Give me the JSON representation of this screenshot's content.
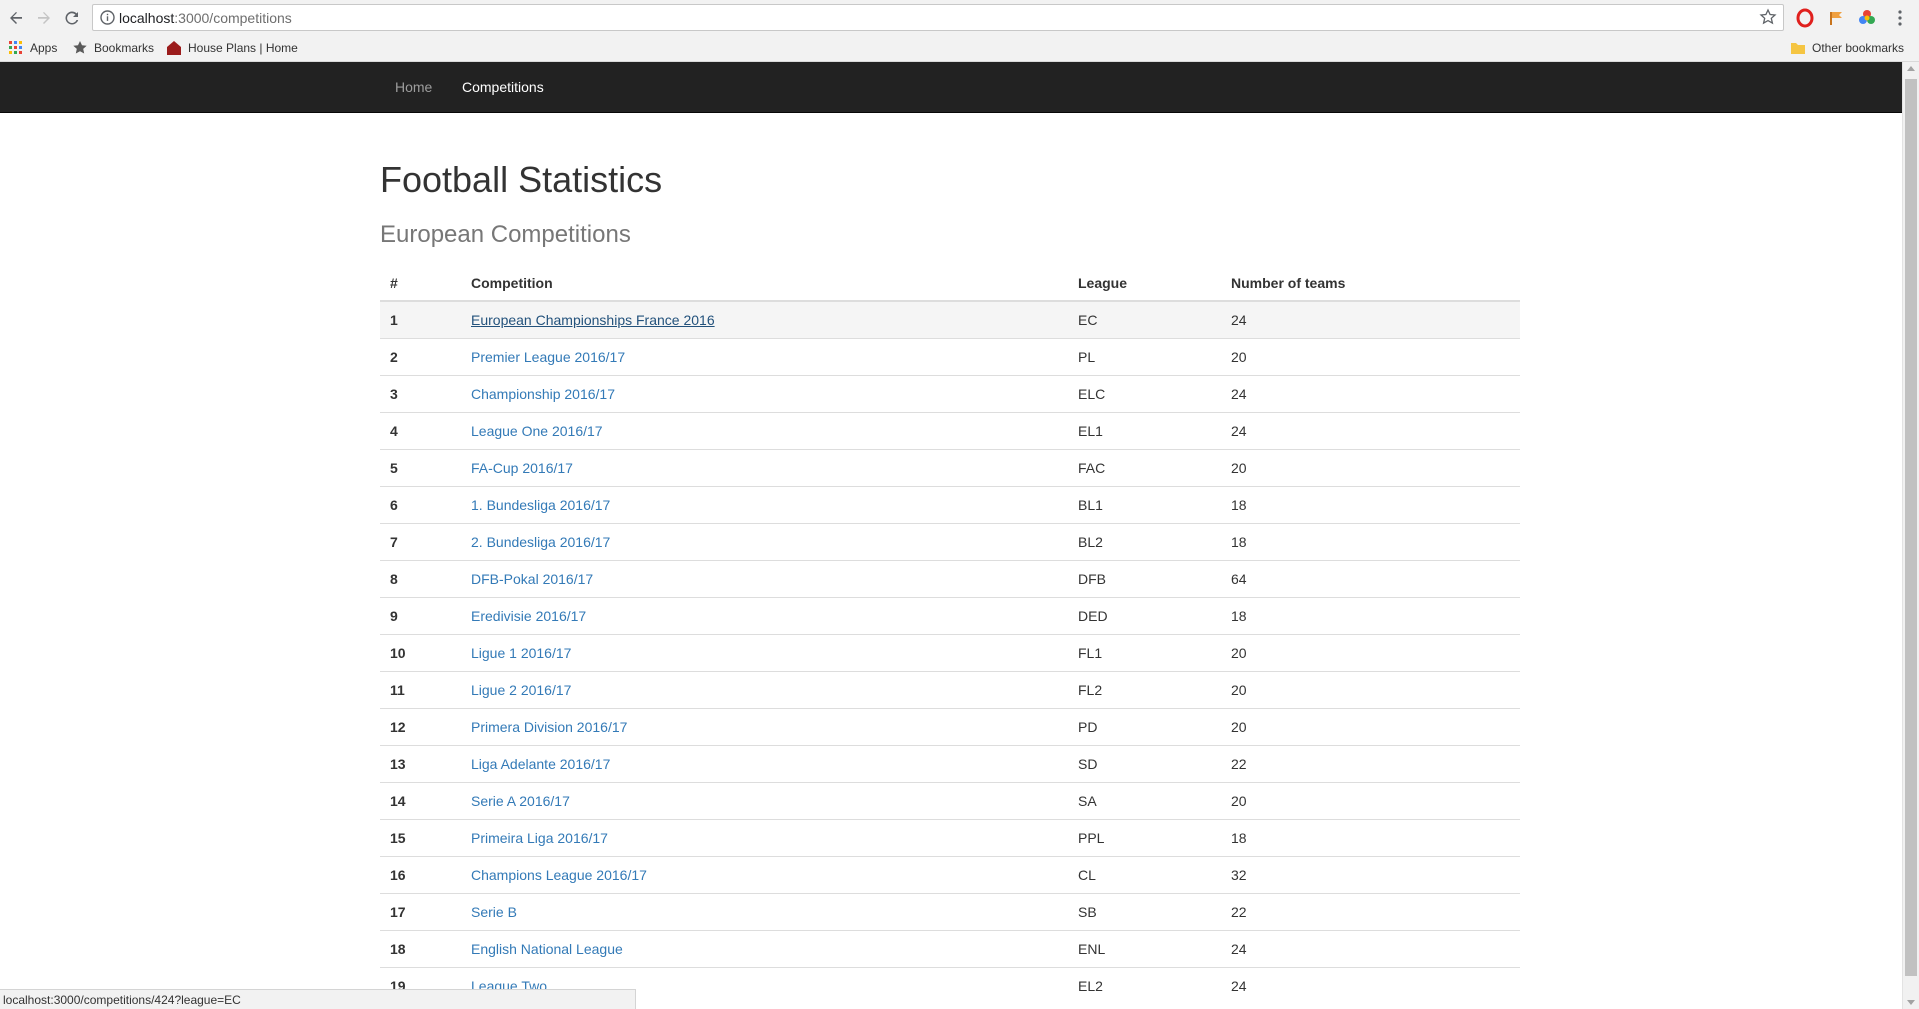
{
  "browser": {
    "url_host": "localhost",
    "url_path": ":3000/competitions",
    "bookmarks": {
      "apps": "Apps",
      "bookmarks": "Bookmarks",
      "house_plans": "House Plans | Home",
      "other": "Other bookmarks"
    },
    "status_url": "localhost:3000/competitions/424?league=EC"
  },
  "nav": {
    "home": "Home",
    "competitions": "Competitions"
  },
  "page": {
    "title": "Football Statistics",
    "subtitle": "European Competitions"
  },
  "table": {
    "headers": [
      "#",
      "Competition",
      "League",
      "Number of teams"
    ],
    "rows": [
      {
        "num": "1",
        "name": "European Championships France 2016",
        "league": "EC",
        "teams": "24"
      },
      {
        "num": "2",
        "name": "Premier League 2016/17",
        "league": "PL",
        "teams": "20"
      },
      {
        "num": "3",
        "name": "Championship 2016/17",
        "league": "ELC",
        "teams": "24"
      },
      {
        "num": "4",
        "name": "League One 2016/17",
        "league": "EL1",
        "teams": "24"
      },
      {
        "num": "5",
        "name": "FA-Cup 2016/17",
        "league": "FAC",
        "teams": "20"
      },
      {
        "num": "6",
        "name": "1. Bundesliga 2016/17",
        "league": "BL1",
        "teams": "18"
      },
      {
        "num": "7",
        "name": "2. Bundesliga 2016/17",
        "league": "BL2",
        "teams": "18"
      },
      {
        "num": "8",
        "name": "DFB-Pokal 2016/17",
        "league": "DFB",
        "teams": "64"
      },
      {
        "num": "9",
        "name": "Eredivisie 2016/17",
        "league": "DED",
        "teams": "18"
      },
      {
        "num": "10",
        "name": "Ligue 1 2016/17",
        "league": "FL1",
        "teams": "20"
      },
      {
        "num": "11",
        "name": "Ligue 2 2016/17",
        "league": "FL2",
        "teams": "20"
      },
      {
        "num": "12",
        "name": "Primera Division 2016/17",
        "league": "PD",
        "teams": "20"
      },
      {
        "num": "13",
        "name": "Liga Adelante 2016/17",
        "league": "SD",
        "teams": "22"
      },
      {
        "num": "14",
        "name": "Serie A 2016/17",
        "league": "SA",
        "teams": "20"
      },
      {
        "num": "15",
        "name": "Primeira Liga 2016/17",
        "league": "PPL",
        "teams": "18"
      },
      {
        "num": "16",
        "name": "Champions League 2016/17",
        "league": "CL",
        "teams": "32"
      },
      {
        "num": "17",
        "name": "Serie B",
        "league": "SB",
        "teams": "22"
      },
      {
        "num": "18",
        "name": "English National League",
        "league": "ENL",
        "teams": "24"
      },
      {
        "num": "19",
        "name": "League Two",
        "league": "EL2",
        "teams": "24"
      }
    ]
  },
  "colors": {
    "navbar_bg": "#222222",
    "link": "#337ab7",
    "link_hover": "#23527c",
    "row_hover": "#f5f5f5"
  }
}
